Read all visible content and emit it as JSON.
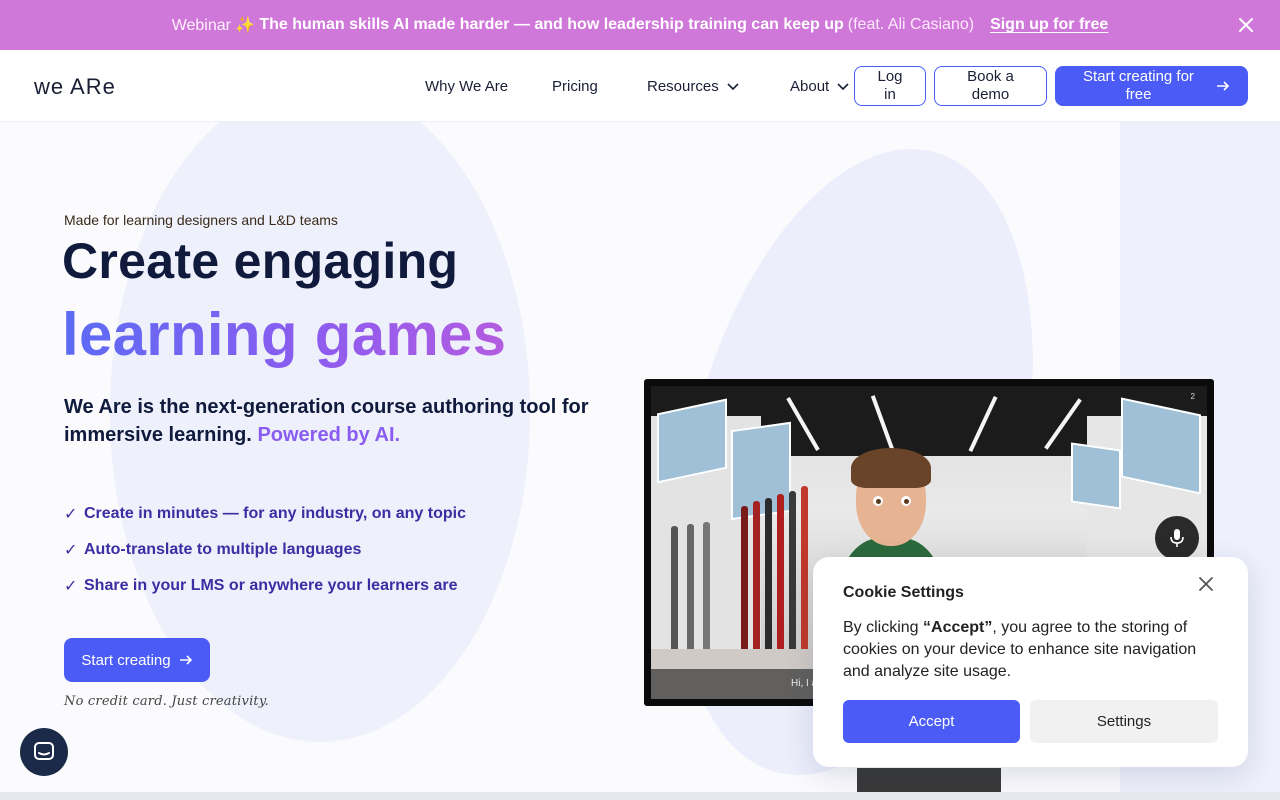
{
  "banner": {
    "pre": "Webinar ✨",
    "main": "The human skills AI made harder — and how leadership training can keep up",
    "feat": "(feat. Ali Casiano)",
    "cta": "Sign up for free",
    "close_icon": "close-icon"
  },
  "header": {
    "logo": "we ARe",
    "nav": {
      "why": "Why We Are",
      "pricing": "Pricing",
      "resources": "Resources",
      "about": "About"
    },
    "login": "Log in",
    "demo": "Book a demo",
    "start": "Start creating for free"
  },
  "hero": {
    "eyebrow": "Made for learning designers and L&D teams",
    "title_line1": "Create engaging",
    "title_line2": "learning games",
    "lead_main": "We Are is the next-generation course authoring tool for immersive learning.",
    "lead_ai": "Powered by AI.",
    "benefits": [
      "Create in minutes — for any industry, on any topic",
      "Auto-translate to multiple languages",
      "Share in your LMS or anywhere your learners are"
    ],
    "cta": "Start creating",
    "note": "No credit card. Just creativity."
  },
  "preview": {
    "subtitle": "Hi, I am",
    "hud": "2"
  },
  "cookie": {
    "title": "Cookie Settings",
    "body_pre": "By clicking ",
    "body_bold": "“Accept”",
    "body_post": ", you agree to the storing of cookies on your device to enhance site navigation and analyze site usage.",
    "accept": "Accept",
    "settings": "Settings"
  },
  "colors": {
    "banner": "#cf78d9",
    "primary": "#4a5cf5",
    "heading": "#0f1a3c",
    "benefit": "#3b2ea3",
    "ai": "#8a5df2"
  }
}
